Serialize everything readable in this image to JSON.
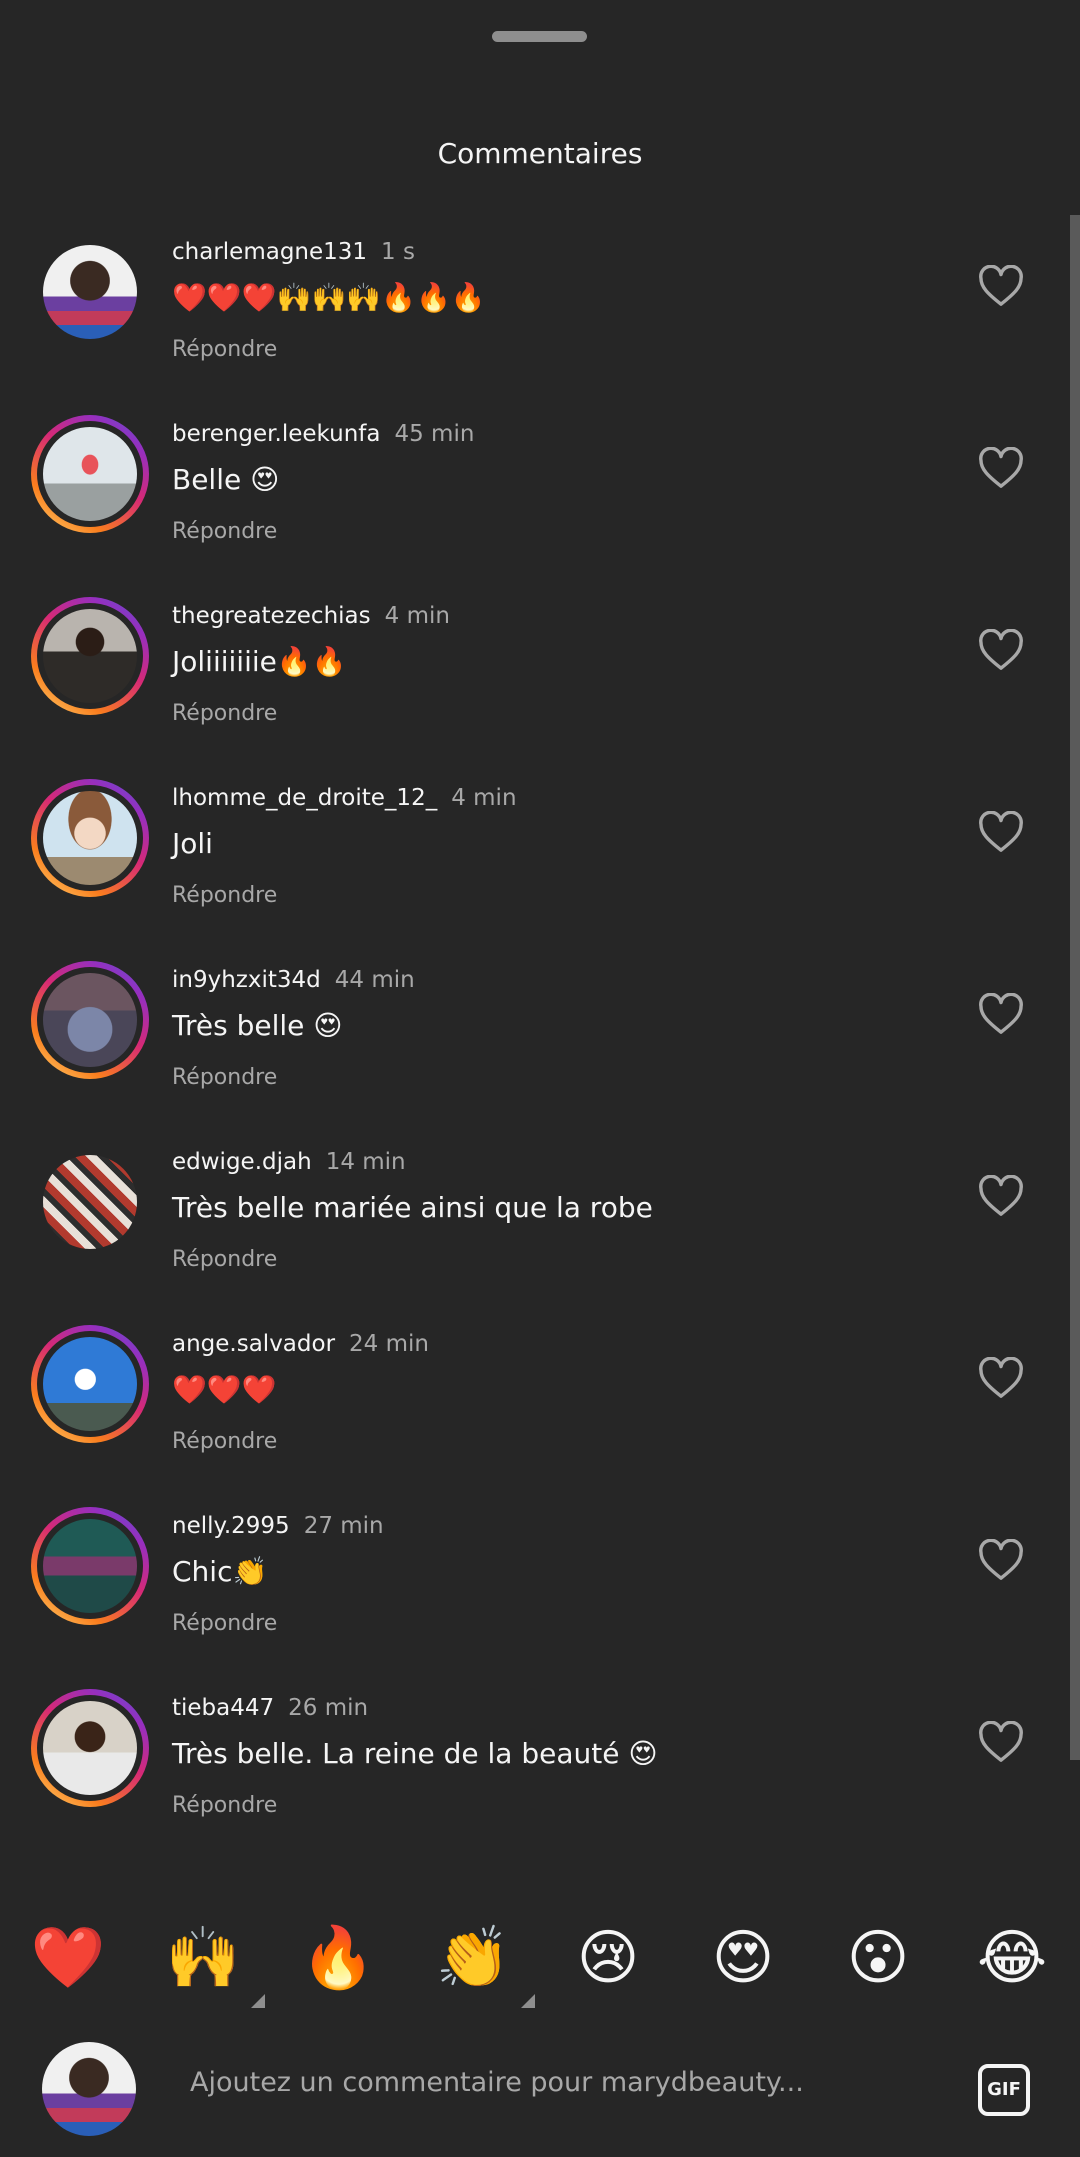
{
  "sheet": {
    "title": "Commentaires"
  },
  "comments": [
    {
      "user": "charlemagne131",
      "time": "1 s",
      "text": "❤️❤️❤️🙌🙌🙌🔥🔥🔥",
      "reply": "Répondre",
      "ring": false
    },
    {
      "user": "berenger.leekunfa",
      "time": "45 min",
      "text": "Belle 😍",
      "reply": "Répondre",
      "ring": true
    },
    {
      "user": "thegreatezechias",
      "time": "4 min",
      "text": "Joliiiiiiie🔥🔥",
      "reply": "Répondre",
      "ring": true
    },
    {
      "user": "lhomme_de_droite_12_",
      "time": "4 min",
      "text": "Joli",
      "reply": "Répondre",
      "ring": true
    },
    {
      "user": "in9yhzxit34d",
      "time": "44 min",
      "text": "Très belle 😍",
      "reply": "Répondre",
      "ring": true
    },
    {
      "user": "edwige.djah",
      "time": "14 min",
      "text": "Très belle mariée ainsi que la robe",
      "reply": "Répondre",
      "ring": false
    },
    {
      "user": "ange.salvador",
      "time": "24 min",
      "text": "❤️❤️❤️",
      "reply": "Répondre",
      "ring": true
    },
    {
      "user": "nelly.2995",
      "time": "27 min",
      "text": "Chic👏",
      "reply": "Répondre",
      "ring": true
    },
    {
      "user": "tieba447",
      "time": "26 min",
      "text": "Très belle. La reine de la beauté 😍",
      "reply": "Répondre",
      "ring": true
    }
  ],
  "reactions": [
    "❤️",
    "🙌",
    "🔥",
    "👏",
    "😢",
    "😍",
    "😮",
    "😂"
  ],
  "composer": {
    "placeholder": "Ajoutez un commentaire pour marydbeauty...",
    "gif_label": "GIF"
  },
  "colors": {
    "background": "#262626",
    "text": "#f5f5f5",
    "muted": "#a8a8a8",
    "story_ring_start": "#fa7e1e",
    "story_ring_end": "#962fbf"
  }
}
